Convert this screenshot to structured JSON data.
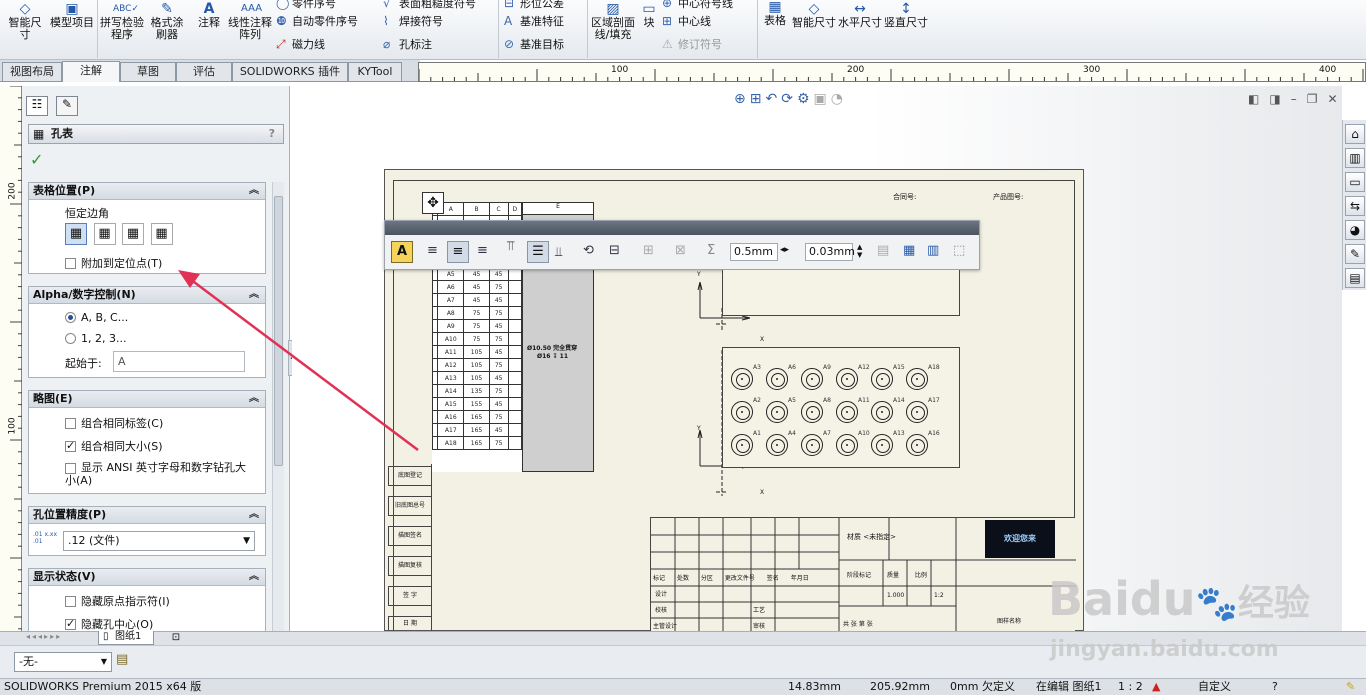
{
  "app": {
    "product_status": "SOLIDWORKS Premium 2015 x64 版"
  },
  "ribbon": {
    "big": [
      "智能尺寸",
      "模型项目",
      "拼写检验程序",
      "格式涂刷器",
      "注释",
      "线性注释阵列"
    ],
    "small1": [
      "零件序号",
      "自动零件序号",
      "磁力线"
    ],
    "small2": [
      "表面粗糙度符号",
      "焊接符号",
      "孔标注"
    ],
    "small3": [
      "形位公差",
      "基准特征",
      "基准目标"
    ],
    "area_hatch": "区域剖面线/填充",
    "block": "块",
    "small4": [
      "中心符号线",
      "中心线",
      "修订符号"
    ],
    "table": "表格",
    "right_big": [
      "智能尺寸",
      "水平尺寸",
      "竖直尺寸"
    ]
  },
  "tabs": [
    "视图布局",
    "注解",
    "草图",
    "评估",
    "SOLIDWORKS 插件",
    "KYTool"
  ],
  "ruler": {
    "h": [
      "100",
      "200",
      "300",
      "400"
    ],
    "v": [
      "200",
      "100"
    ]
  },
  "pm": {
    "title": "孔表",
    "help": "?",
    "ok": "✓",
    "sections": {
      "table_pos": {
        "title": "表格位置(P)",
        "anchor_label": "恒定边角",
        "attach": "附加到定位点(T)"
      },
      "alpha": {
        "title": "Alpha/数字控制(N)",
        "opt1": "A, B, C...",
        "opt2": "1, 2, 3...",
        "start_label": "起始于:",
        "start_value": "A"
      },
      "scheme": {
        "title": "略图(E)",
        "opt1": "组合相同标签(C)",
        "opt2": "组合相同大小(S)",
        "opt3": "显示 ANSI 英寸字母和数字钻孔大小(A)"
      },
      "precision": {
        "title": "孔位置精度(P)",
        "icon": ".01 x.xx .01",
        "value": ".12 (文件)"
      },
      "display": {
        "title": "显示状态(V)",
        "opt1": "隐藏原点指示符(I)",
        "opt2": "隐藏孔中心(O)"
      }
    }
  },
  "format_bar": {
    "gap1": "0.5mm",
    "gap2": "0.03mm"
  },
  "sheet": {
    "hole_table_header": [
      "A",
      "B",
      "C",
      "D",
      "E"
    ],
    "hole_rows": [
      "A4",
      "A5",
      "A6",
      "A7",
      "A8",
      "A9",
      "A10",
      "A11",
      "A12",
      "A13",
      "A14",
      "A15",
      "A16",
      "A17",
      "A18"
    ],
    "hole_x": [
      "45",
      "45",
      "45",
      "45",
      "75",
      "75",
      "75",
      "105",
      "105",
      "105",
      "135",
      "155",
      "165",
      "165",
      "165"
    ],
    "hole_y": [
      "75",
      "45",
      "75",
      "45",
      "75",
      "45",
      "75",
      "45",
      "75",
      "45",
      "75",
      "45",
      "75",
      "45",
      "75"
    ],
    "hole_note": "Ø10.50 完全贯穿",
    "hole_note2": "Ø16 ↧ 11",
    "axis_y": "Y",
    "axis_x": "X",
    "hole_labels_top": [
      "A3",
      "A6",
      "A9",
      "A12",
      "A15",
      "A18"
    ],
    "hole_labels_mid": [
      "A2",
      "A5",
      "A8",
      "A11",
      "A14",
      "A17"
    ],
    "hole_labels_bot": [
      "A1",
      "A4",
      "A7",
      "A10",
      "A13",
      "A16"
    ],
    "header_labels": [
      "合同号:",
      "产品图号:"
    ],
    "left_strip": [
      "底图登记",
      "旧底图总号",
      "描图签名",
      "描图复核",
      "签  字",
      "日  期"
    ],
    "title_block": {
      "material": "材质 <未指定>",
      "rows": [
        "标记",
        "处数",
        "分区",
        "更改文件号",
        "签名",
        "年月日"
      ],
      "roles": [
        "设计",
        "校核",
        "主管设计"
      ],
      "roles2": [
        "工艺",
        "审核"
      ],
      "scale_hdr": [
        "阶段标记",
        "质量",
        "比例"
      ],
      "scale_val": [
        "1.000",
        "1:2"
      ],
      "sheet_info": "共  张  第  张",
      "drawing_no": "图样名称",
      "banner": "欢迎您来"
    }
  },
  "tb2": {
    "sheet_tab": "图纸1"
  },
  "bottom": {
    "dropdown": "-无-"
  },
  "status": {
    "x": "14.83mm",
    "y": "205.92mm",
    "z": "0mm",
    "state": "欠定义",
    "edit": "在编辑 图纸1",
    "scale": "1 : 2",
    "units": "自定义"
  },
  "watermark": {
    "brand": "Baidu",
    "brand_cn": "经验",
    "url": "jingyan.baidu.com"
  },
  "colors": {
    "accent": "#2458a8",
    "arrow": "#e03255",
    "tab_active": "#f4f6f8",
    "sheet": "#f3f0e4"
  }
}
